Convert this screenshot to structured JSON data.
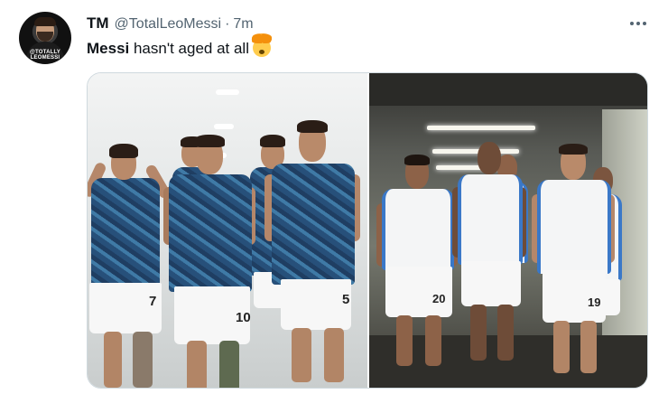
{
  "tweet": {
    "avatar": {
      "text": "@TOTALLY\nLEOMESSI"
    },
    "display_name": "TM",
    "handle": "@TotalLeoMessi",
    "separator": "·",
    "time": "7m",
    "text_bold": "Messi",
    "text_rest": " hasn't aged at all",
    "emoji": "exploding-head-emoji",
    "more_icon": "more-horizontal-icon"
  },
  "media": {
    "left": {
      "numbers": [
        "7",
        "10",
        "5"
      ]
    },
    "right": {
      "numbers": [
        "20",
        "19"
      ]
    }
  },
  "colors": {
    "text_primary": "#0f1419",
    "text_secondary": "#536471",
    "border": "#cfd9de",
    "kit_blue": "#27507a",
    "kit_white_accent": "#3a78c8"
  }
}
